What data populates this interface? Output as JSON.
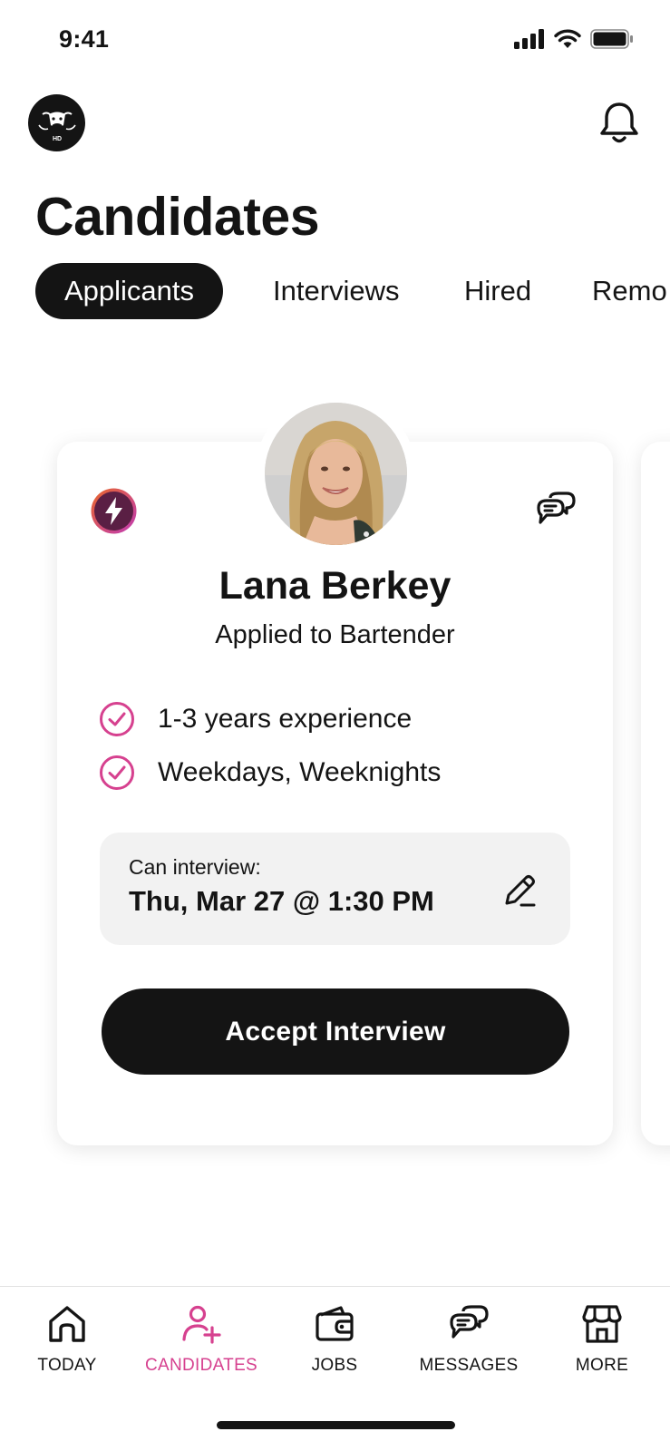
{
  "status_bar": {
    "time": "9:41"
  },
  "header": {
    "title": "Candidates",
    "logo_text": "HD"
  },
  "tabs": [
    {
      "label": "Applicants",
      "active": true
    },
    {
      "label": "Interviews",
      "active": false
    },
    {
      "label": "Hired",
      "active": false
    },
    {
      "label": "Remo",
      "active": false
    }
  ],
  "candidate": {
    "name": "Lana Berkey",
    "applied_to": "Applied to Bartender",
    "qualifications": [
      "1-3 years experience",
      "Weekdays, Weeknights"
    ],
    "interview_label": "Can interview:",
    "interview_time": "Thu, Mar 27 @ 1:30 PM",
    "accept_label": "Accept Interview"
  },
  "bottom_nav": [
    {
      "label": "TODAY",
      "icon": "home-icon",
      "active": false
    },
    {
      "label": "CANDIDATES",
      "icon": "add-person-icon",
      "active": true
    },
    {
      "label": "JOBS",
      "icon": "wallet-icon",
      "active": false
    },
    {
      "label": "MESSAGES",
      "icon": "chat-bubbles-icon",
      "active": false
    },
    {
      "label": "MORE",
      "icon": "store-icon",
      "active": false
    }
  ],
  "colors": {
    "accent": "#d6418f",
    "dark": "#141414",
    "bolt_gradient_start": "#e8672a",
    "bolt_gradient_end": "#c13bb5",
    "bolt_fill": "#5a1f44"
  }
}
